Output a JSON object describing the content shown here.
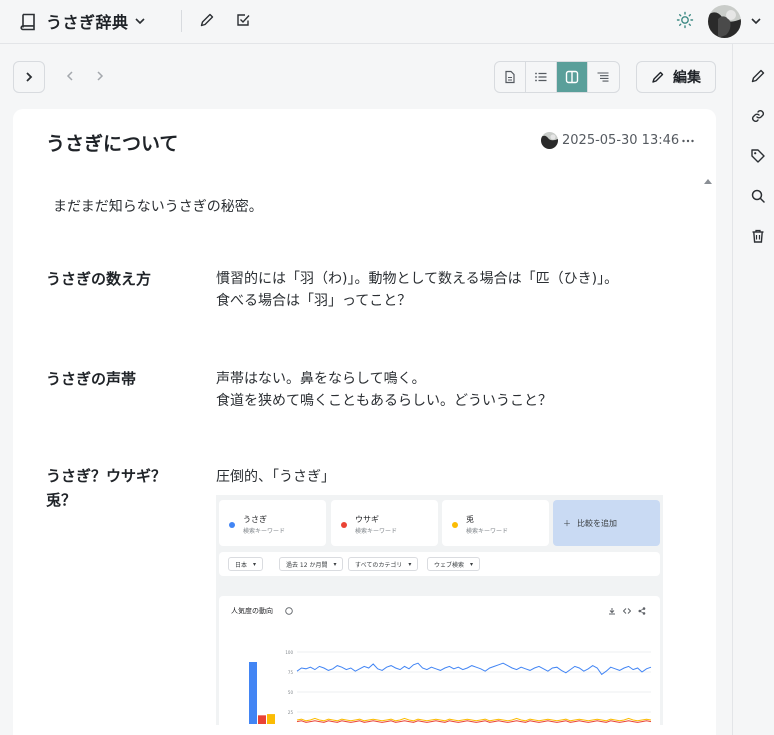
{
  "header": {
    "app_title": "うさぎ辞典",
    "icons": [
      "book-icon",
      "chevron-down-icon",
      "pencil-icon",
      "checkbox-icon",
      "sun-icon",
      "avatar",
      "chevron-down-icon"
    ]
  },
  "toolbar": {
    "edit_label": "編集",
    "view_modes": [
      "document-icon",
      "list-icon",
      "split-icon",
      "outline-icon"
    ],
    "active_view": "split-icon"
  },
  "right_rail": {
    "icons": [
      "pencil-icon",
      "link-icon",
      "tag-icon",
      "search-icon",
      "trash-icon"
    ]
  },
  "page": {
    "title": "うさぎについて",
    "date": "2025-05-30 13:46",
    "intro": "まだまだ知らないうさぎの秘密。",
    "entries": [
      {
        "term": "うさぎの数え方",
        "lines": [
          "慣習的には「羽（わ)」。動物として数える場合は「匹（ひき)」。",
          "食べる場合は「羽」ってこと？"
        ]
      },
      {
        "term": "うさぎの声帯",
        "lines": [
          "声帯はない。鼻をならして鳴く。",
          "食道を狭めて鳴くこともあるらしい。どういうこと？"
        ]
      },
      {
        "term_lines": [
          "うさぎ？ウサギ？",
          "兎？"
        ],
        "lines": [
          "圧倒的、「うさぎ」"
        ]
      }
    ]
  },
  "trends_image": {
    "keywords": [
      {
        "name": "うさぎ",
        "sub": "検索キーワード",
        "color": "#4285f4"
      },
      {
        "name": "ウサギ",
        "sub": "検索キーワード",
        "color": "#ea4335"
      },
      {
        "name": "兎",
        "sub": "検索キーワード",
        "color": "#fbbc04"
      }
    ],
    "add_label": "比較を追加",
    "filters": [
      "日本",
      "過去 12 か月間",
      "すべてのカテゴリ",
      "ウェブ検索"
    ],
    "chart_title": "人気度の動向",
    "y_ticks": [
      "100",
      "75",
      "50",
      "25"
    ],
    "bar_values": [
      100,
      14,
      16
    ],
    "series": [
      {
        "name": "うさぎ",
        "color": "#4285f4",
        "values": [
          76,
          80,
          79,
          81,
          78,
          82,
          80,
          77,
          79,
          83,
          81,
          78,
          80,
          76,
          79,
          82,
          80,
          85,
          79,
          77,
          81,
          83,
          80,
          78,
          82,
          79,
          84,
          86,
          80,
          78,
          81,
          79,
          77,
          80,
          82,
          79,
          81,
          78,
          80,
          83,
          81,
          79,
          76,
          80,
          82,
          84,
          86,
          83,
          80,
          78,
          81,
          79,
          77,
          80,
          82,
          79,
          76,
          80,
          81,
          77,
          74,
          78,
          82,
          80,
          76,
          79,
          83,
          80,
          72,
          76,
          81,
          79,
          77,
          80,
          82,
          78,
          80,
          75,
          79,
          81
        ]
      },
      {
        "name": "ウサギ",
        "color": "#ea4335",
        "values": [
          13,
          14,
          12,
          13,
          14,
          13,
          12,
          14,
          13,
          12,
          14,
          13,
          12,
          13,
          14,
          12,
          13,
          14,
          13,
          12,
          13,
          14,
          12,
          13,
          14,
          13,
          12,
          14,
          13,
          12,
          13,
          14,
          13,
          12,
          14,
          13,
          12,
          13,
          14,
          13,
          12,
          13,
          14,
          12,
          13,
          14,
          13,
          12,
          13,
          14,
          13,
          12,
          14,
          13,
          12,
          13,
          14,
          13,
          12,
          13,
          14,
          12,
          13,
          14,
          13,
          12,
          13,
          14,
          13,
          12,
          14,
          13,
          12,
          13,
          14,
          13,
          12,
          13,
          14,
          13
        ]
      },
      {
        "name": "兎",
        "color": "#fbbc04",
        "values": [
          15,
          16,
          14,
          15,
          17,
          15,
          14,
          16,
          15,
          14,
          16,
          15,
          14,
          15,
          16,
          14,
          15,
          16,
          15,
          14,
          15,
          16,
          14,
          15,
          17,
          15,
          14,
          16,
          15,
          14,
          15,
          16,
          15,
          14,
          16,
          15,
          14,
          15,
          16,
          15,
          14,
          15,
          16,
          14,
          15,
          16,
          15,
          14,
          15,
          17,
          15,
          14,
          16,
          15,
          14,
          15,
          16,
          15,
          14,
          15,
          16,
          14,
          15,
          16,
          15,
          14,
          15,
          16,
          15,
          14,
          16,
          15,
          14,
          15,
          17,
          15,
          14,
          15,
          16,
          15
        ]
      }
    ]
  }
}
